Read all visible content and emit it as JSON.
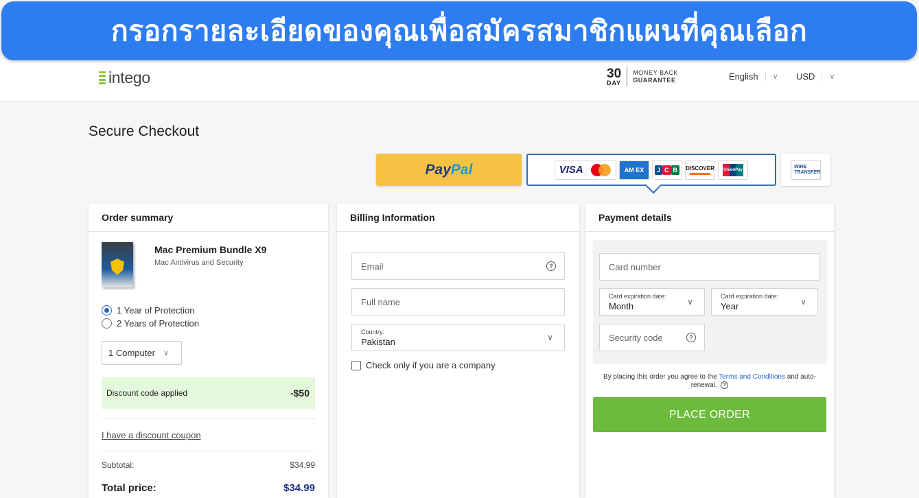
{
  "banner": {
    "text": "กรอกรายละเอียดของคุณเพื่อสมัครสมาชิกแผนที่คุณเลือก"
  },
  "header": {
    "logo_text": "intego",
    "guarantee": {
      "number": "30",
      "unit": "DAY",
      "line1": "MONEY BACK",
      "line2": "GUARANTEE"
    },
    "language": "English",
    "currency": "USD"
  },
  "checkout_title": "Secure Checkout",
  "payment_methods": {
    "paypal": {
      "part1": "Pay",
      "part2": "Pal"
    },
    "cards": [
      "VISA",
      "Mastercard",
      "AMEX",
      "JCB",
      "DISCOVER",
      "UnionPay"
    ],
    "cards_text": {
      "visa": "VISA",
      "amex": "AM EX",
      "jcb": "JCB",
      "discover": "DISCOVER",
      "unionpay": "UnionPay"
    },
    "wire": {
      "line1": "WIRE",
      "line2": "TRANSFER"
    }
  },
  "order_summary": {
    "heading": "Order summary",
    "product_name": "Mac Premium Bundle X9",
    "product_sub": "Mac Antivirus and Security",
    "options": [
      "1 Year of Protection",
      "2 Years of Protection"
    ],
    "selected_option": 0,
    "computers": "1 Computer",
    "discount_label": "Discount code applied",
    "discount_amount": "-$50",
    "coupon_link": "I have a discount coupon",
    "subtotal_label": "Subtotal:",
    "subtotal_value": "$34.99",
    "total_label": "Total price:",
    "total_value": "$34.99"
  },
  "billing": {
    "heading": "Billing Information",
    "email_placeholder": "Email",
    "fullname_placeholder": "Full name",
    "country_label": "Country:",
    "country_value": "Pakistan",
    "company_check": "Check only if you are a company"
  },
  "payment": {
    "heading": "Payment details",
    "card_number_placeholder": "Card number",
    "exp_label": "Card expiration date:",
    "exp_month": "Month",
    "exp_year": "Year",
    "security_placeholder": "Security code",
    "terms_prefix": "By placing this order you agree to the",
    "terms_link": "Terms and Conditions",
    "terms_suffix": "and auto-renewal.",
    "place_order": "PLACE ORDER"
  },
  "colors": {
    "banner": "#2e7df0",
    "place_order": "#6cbb3c",
    "discount_bg": "#e4f8db",
    "accent": "#2f6fb7"
  }
}
